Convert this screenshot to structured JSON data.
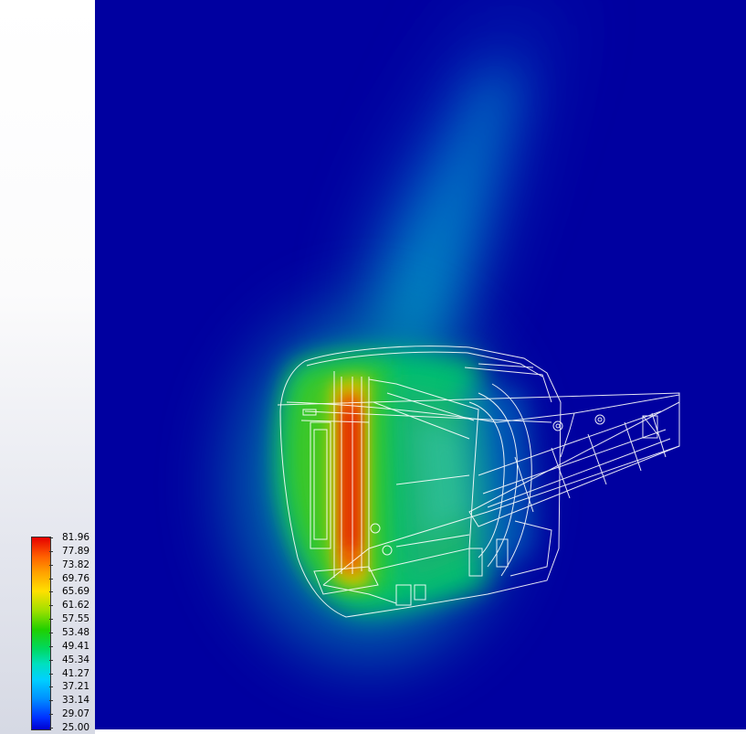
{
  "legend": {
    "values": [
      "81.96",
      "77.89",
      "73.82",
      "69.76",
      "65.69",
      "61.62",
      "57.55",
      "53.48",
      "49.41",
      "45.34",
      "41.27",
      "37.21",
      "33.14",
      "29.07",
      "25.00"
    ],
    "max_color": "#e60000",
    "min_color": "#0000d0"
  },
  "viewport": {
    "background": "#0000a0",
    "model_wireframe_color": "#ffffff"
  }
}
